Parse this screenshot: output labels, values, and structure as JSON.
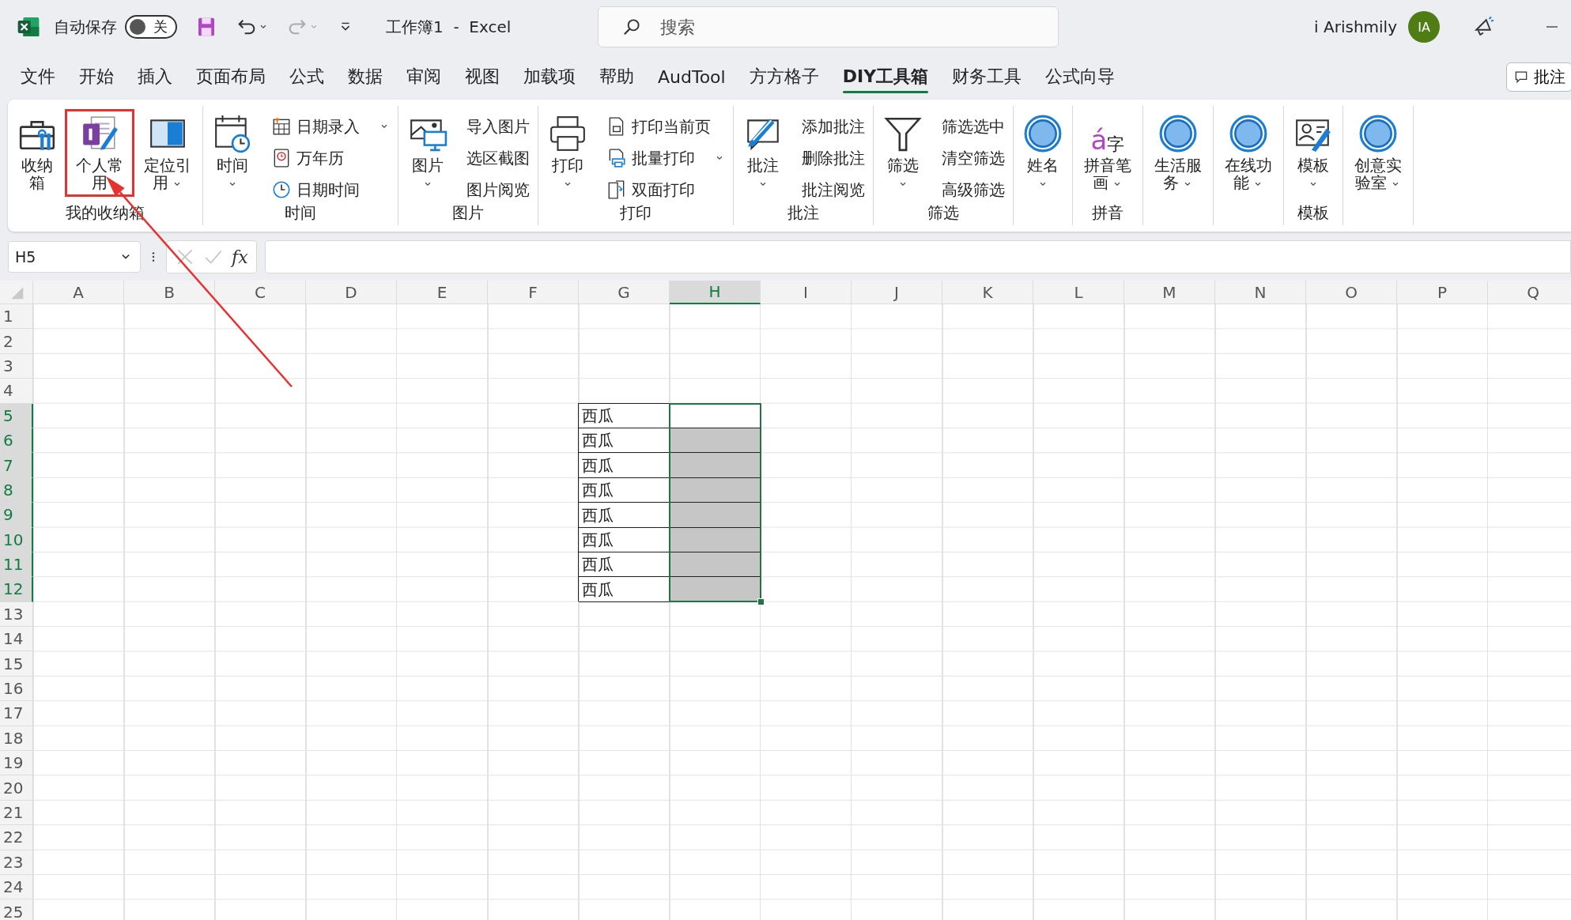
{
  "title_bar": {
    "autosave_label": "自动保存",
    "autosave": {
      "on": false,
      "label": "关"
    },
    "title": "工作簿1  -  Excel",
    "search": {
      "placeholder": "搜索"
    },
    "user_name": "i Arishmily",
    "avatar": "IA"
  },
  "menu_tabs": [
    {
      "label": "文件",
      "selected": false
    },
    {
      "label": "开始",
      "selected": false
    },
    {
      "label": "插入",
      "selected": false
    },
    {
      "label": "页面布局",
      "selected": false
    },
    {
      "label": "公式",
      "selected": false
    },
    {
      "label": "数据",
      "selected": false
    },
    {
      "label": "审阅",
      "selected": false
    },
    {
      "label": "视图",
      "selected": false
    },
    {
      "label": "加载项",
      "selected": false
    },
    {
      "label": "帮助",
      "selected": false
    },
    {
      "label": "AudTool",
      "selected": false
    },
    {
      "label": "方方格子",
      "selected": false
    },
    {
      "label": "DIY工具箱",
      "selected": true
    },
    {
      "label": "财务工具",
      "selected": false
    },
    {
      "label": "公式向导",
      "selected": false
    }
  ],
  "comment_button": "批注",
  "ribbon_groups": [
    {
      "label": "我的收纳箱",
      "large_buttons": [
        {
          "label": "收纳箱",
          "dropdown": false
        },
        {
          "label": "个人常用",
          "dropdown": false
        },
        {
          "label": "定位引用",
          "dropdown": true
        }
      ]
    },
    {
      "label": "时间",
      "large_buttons": [
        {
          "label": "时间",
          "dropdown": true
        }
      ],
      "small_buttons": [
        {
          "label": "日期录入",
          "dropdown": true
        },
        {
          "label": "万年历",
          "dropdown": false
        },
        {
          "label": "日期时间",
          "dropdown": false
        }
      ]
    },
    {
      "label": "图片",
      "large_buttons": [
        {
          "label": "图片",
          "dropdown": true
        }
      ],
      "small_buttons": [
        {
          "label": "导入图片",
          "dropdown": false
        },
        {
          "label": "选区截图",
          "dropdown": false
        },
        {
          "label": "图片阅览",
          "dropdown": false
        }
      ]
    },
    {
      "label": "打印",
      "large_buttons": [
        {
          "label": "打印",
          "dropdown": true
        }
      ],
      "small_buttons": [
        {
          "label": "打印当前页",
          "dropdown": false
        },
        {
          "label": "批量打印",
          "dropdown": true
        },
        {
          "label": "双面打印",
          "dropdown": false
        }
      ]
    },
    {
      "label": "批注",
      "large_buttons": [
        {
          "label": "批注",
          "dropdown": true
        }
      ],
      "small_buttons": [
        {
          "label": "添加批注",
          "dropdown": false
        },
        {
          "label": "删除批注",
          "dropdown": false
        },
        {
          "label": "批注阅览",
          "dropdown": false
        }
      ]
    },
    {
      "label": "筛选",
      "large_buttons": [
        {
          "label": "筛选",
          "dropdown": true
        }
      ],
      "small_buttons": [
        {
          "label": "筛选选中",
          "dropdown": false
        },
        {
          "label": "清空筛选",
          "dropdown": false
        },
        {
          "label": "高级筛选",
          "dropdown": false
        }
      ]
    },
    {
      "large_buttons": [
        {
          "label": "姓名",
          "dropdown": true
        }
      ]
    },
    {
      "label": "拼音",
      "large_buttons": [
        {
          "label": "拼音笔画",
          "dropdown": true,
          "glyph": "á",
          "glyph_2": "字"
        }
      ]
    },
    {
      "large_buttons": [
        {
          "label": "生活服务",
          "dropdown": true
        }
      ]
    },
    {
      "large_buttons": [
        {
          "label": "在线功能",
          "dropdown": true
        }
      ]
    },
    {
      "label": "模板",
      "large_buttons": [
        {
          "label": "模板",
          "dropdown": true
        }
      ]
    },
    {
      "large_buttons": [
        {
          "label": "创意实验室",
          "dropdown": true
        }
      ]
    }
  ],
  "formula_bar": {
    "name_box": "H5",
    "function_label": "fx"
  },
  "grid": {
    "columns": [
      {
        "label": "A",
        "selected": false
      },
      {
        "label": "B",
        "selected": false
      },
      {
        "label": "C",
        "selected": false
      },
      {
        "label": "D",
        "selected": false
      },
      {
        "label": "E",
        "selected": false
      },
      {
        "label": "F",
        "selected": false
      },
      {
        "label": "G",
        "selected": false
      },
      {
        "label": "H",
        "selected": true
      },
      {
        "label": "I",
        "selected": false
      },
      {
        "label": "J",
        "selected": false
      },
      {
        "label": "K",
        "selected": false
      },
      {
        "label": "L",
        "selected": false
      },
      {
        "label": "M",
        "selected": false
      },
      {
        "label": "N",
        "selected": false
      },
      {
        "label": "O",
        "selected": false
      },
      {
        "label": "P",
        "selected": false
      },
      {
        "label": "Q",
        "selected": false
      }
    ],
    "rows": [
      {
        "label": "1",
        "selected": false
      },
      {
        "label": "2",
        "selected": false
      },
      {
        "label": "3",
        "selected": false
      },
      {
        "label": "4",
        "selected": false
      },
      {
        "label": "5",
        "selected": true,
        "cells": {
          "G": {
            "text": "西瓜",
            "bordered": true
          },
          "H": {
            "bordered": true,
            "selected": true,
            "active": true
          }
        }
      },
      {
        "label": "6",
        "selected": true,
        "cells": {
          "G": {
            "text": "西瓜",
            "bordered": true
          },
          "H": {
            "bordered": true,
            "selected": true,
            "active": false
          }
        }
      },
      {
        "label": "7",
        "selected": true,
        "cells": {
          "G": {
            "text": "西瓜",
            "bordered": true
          },
          "H": {
            "bordered": true,
            "selected": true,
            "active": false
          }
        }
      },
      {
        "label": "8",
        "selected": true,
        "cells": {
          "G": {
            "text": "西瓜",
            "bordered": true
          },
          "H": {
            "bordered": true,
            "selected": true,
            "active": false
          }
        }
      },
      {
        "label": "9",
        "selected": true,
        "cells": {
          "G": {
            "text": "西瓜",
            "bordered": true
          },
          "H": {
            "bordered": true,
            "selected": true,
            "active": false
          }
        }
      },
      {
        "label": "10",
        "selected": true,
        "cells": {
          "G": {
            "text": "西瓜",
            "bordered": true
          },
          "H": {
            "bordered": true,
            "selected": true,
            "active": false
          }
        }
      },
      {
        "label": "11",
        "selected": true,
        "cells": {
          "G": {
            "text": "西瓜",
            "bordered": true
          },
          "H": {
            "bordered": true,
            "selected": true,
            "active": false
          }
        }
      },
      {
        "label": "12",
        "selected": true,
        "cells": {
          "G": {
            "text": "西瓜",
            "bordered": true
          },
          "H": {
            "bordered": true,
            "selected": true,
            "active": false
          }
        }
      },
      {
        "label": "13",
        "selected": false
      },
      {
        "label": "14",
        "selected": false
      },
      {
        "label": "15",
        "selected": false
      },
      {
        "label": "16",
        "selected": false
      },
      {
        "label": "17",
        "selected": false
      },
      {
        "label": "18",
        "selected": false
      },
      {
        "label": "19",
        "selected": false
      },
      {
        "label": "20",
        "selected": false
      },
      {
        "label": "21",
        "selected": false
      },
      {
        "label": "22",
        "selected": false
      },
      {
        "label": "23",
        "selected": false
      },
      {
        "label": "24",
        "selected": false
      },
      {
        "label": "25",
        "selected": false
      }
    ]
  }
}
